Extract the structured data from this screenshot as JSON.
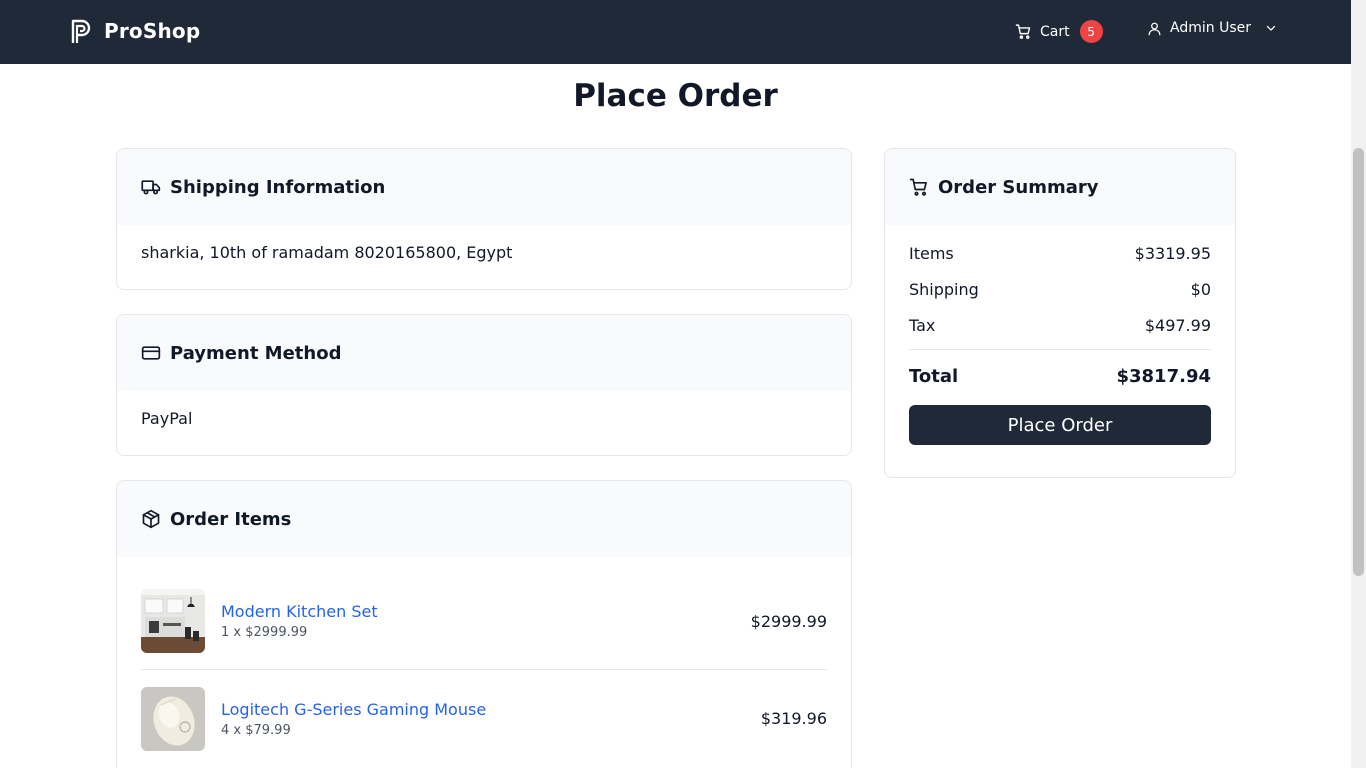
{
  "nav": {
    "brand": "ProShop",
    "cart_label": "Cart",
    "cart_count": "5",
    "user_name": "Admin User"
  },
  "page": {
    "title": "Place Order"
  },
  "shipping": {
    "title": "Shipping Information",
    "address": "sharkia, 10th of ramadam 8020165800, Egypt"
  },
  "payment": {
    "title": "Payment Method",
    "method": "PayPal"
  },
  "order_items": {
    "title": "Order Items",
    "items": [
      {
        "name": "Modern Kitchen Set",
        "qty_line": "1 x $2999.99",
        "total": "$2999.99",
        "image_icon": "kitchen-photo"
      },
      {
        "name": "Logitech G-Series Gaming Mouse",
        "qty_line": "4 x $79.99",
        "total": "$319.96",
        "image_icon": "mouse-photo"
      }
    ]
  },
  "summary": {
    "title": "Order Summary",
    "items_label": "Items",
    "items_value": "$3319.95",
    "shipping_label": "Shipping",
    "shipping_value": "$0",
    "tax_label": "Tax",
    "tax_value": "$497.99",
    "total_label": "Total",
    "total_value": "$3817.94",
    "button_label": "Place Order"
  },
  "colors": {
    "navbar": "#1f2937",
    "badge": "#ef4444",
    "link": "#2563eb",
    "button": "#1f2937"
  }
}
